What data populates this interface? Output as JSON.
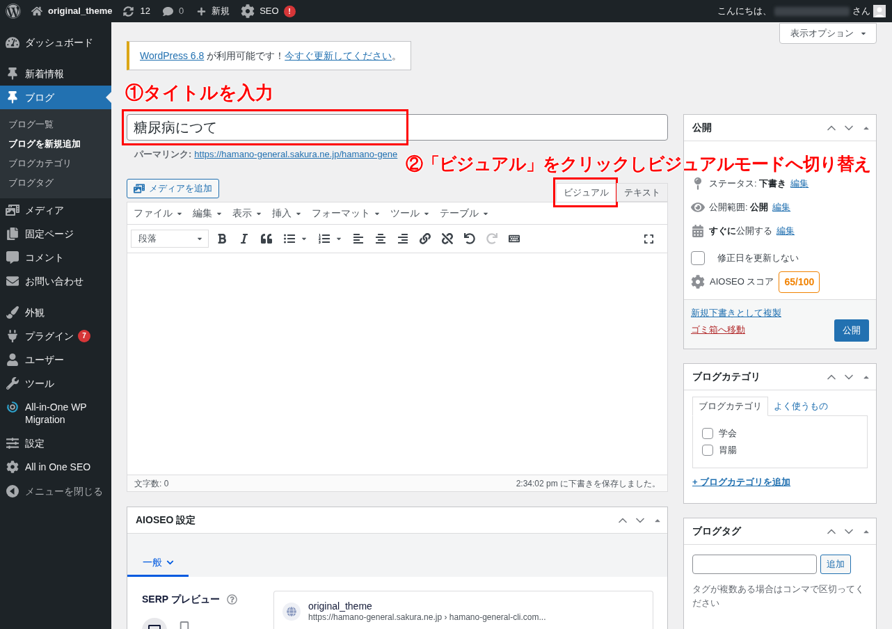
{
  "admin_bar": {
    "site_name": "original_theme",
    "updates_count": "12",
    "comments_count": "0",
    "new_label": "新規",
    "seo_label": "SEO",
    "seo_badge": "!",
    "greeting": "こんにちは、",
    "greeting_suffix": "さん"
  },
  "sidebar": {
    "groups": [
      {
        "items": [
          {
            "label": "ダッシュボード",
            "selected": false
          }
        ]
      },
      {
        "items": [
          {
            "label": "新着情報",
            "selected": false
          },
          {
            "label": "ブログ",
            "selected": true,
            "children": [
              {
                "label": "ブログ一覧",
                "selected": false
              },
              {
                "label": "ブログを新規追加",
                "selected": true
              },
              {
                "label": "ブログカテゴリ",
                "selected": false
              },
              {
                "label": "ブログタグ",
                "selected": false
              }
            ]
          },
          {
            "label": "メディア",
            "selected": false
          },
          {
            "label": "固定ページ",
            "selected": false
          },
          {
            "label": "コメント",
            "selected": false
          },
          {
            "label": "お問い合わせ",
            "selected": false
          }
        ]
      },
      {
        "items": [
          {
            "label": "外観",
            "selected": false
          },
          {
            "label": "プラグイン",
            "selected": false,
            "badge": "7"
          },
          {
            "label": "ユーザー",
            "selected": false
          },
          {
            "label": "ツール",
            "selected": false
          },
          {
            "label": "All-in-One WP Migration",
            "selected": false
          },
          {
            "label": "設定",
            "selected": false
          },
          {
            "label": "All in One SEO",
            "selected": false
          }
        ]
      }
    ],
    "collapse_label": "メニューを閉じる"
  },
  "screen_options": "表示オプション",
  "notice": {
    "parts": [
      {
        "kind": "link",
        "text": "WordPress 6.8"
      },
      {
        "kind": "text",
        "text": " が利用可能です！"
      },
      {
        "kind": "link",
        "text": "今すぐ更新してください"
      },
      {
        "kind": "text",
        "text": "。"
      }
    ]
  },
  "annotations": [
    {
      "text": "①タイトルを入力"
    },
    {
      "text": "②「ビジュアル」をクリックしビジュアルモードへ切り替え"
    }
  ],
  "editor": {
    "title": {
      "value": "糖尿病につて",
      "highlighted": true
    },
    "permalink": {
      "label": "パーマリンク:",
      "url": "https://hamano-general.sakura.ne.jp/hamano-gene"
    },
    "add_media": "メディアを追加",
    "tabs": [
      {
        "label": "ビジュアル",
        "selected": true,
        "highlighted": true
      },
      {
        "label": "テキスト",
        "selected": false,
        "highlighted": false
      }
    ],
    "menus": [
      "ファイル",
      "編集",
      "表示",
      "挿入",
      "フォーマット",
      "ツール",
      "テーブル"
    ],
    "format": "段落",
    "toolbar": {
      "redo_disabled": true
    },
    "word_count": "文字数: 0",
    "save_status": "2:34:02 pm に下書きを保存しました。"
  },
  "aioseo": {
    "title": "AIOSEO 設定",
    "tabs": [
      {
        "label": "一般",
        "selected": true
      }
    ],
    "serp_label": "SERP プレビュー",
    "preview": {
      "site_name": "original_theme",
      "url": "https://hamano-general.sakura.ne.jp › hamano-general-cli.com..."
    }
  },
  "publish": {
    "title": "公開",
    "rows": [
      {
        "text": "ステータス: **下書き**",
        "link": "編集"
      },
      {
        "text": "公開範囲: **公開**",
        "link": "編集"
      },
      {
        "text": "**すぐに**公開する",
        "link": "編集"
      }
    ],
    "checkbox": {
      "label": "修正日を更新しない",
      "checked": false
    },
    "score": {
      "label": "AIOSEO スコア",
      "value": "65/100"
    },
    "duplicate_link": "新規下書きとして複製",
    "trash_link": "ゴミ箱へ移動",
    "publish_button": "公開"
  },
  "categories": {
    "title": "ブログカテゴリ",
    "tabs": [
      {
        "label": "ブログカテゴリ",
        "selected": true
      },
      {
        "label": "よく使うもの",
        "selected": false
      }
    ],
    "items": [
      {
        "label": "学会",
        "checked": false
      },
      {
        "label": "胃腸",
        "checked": false
      }
    ],
    "add_link": "+ ブログカテゴリを追加"
  },
  "tags": {
    "title": "ブログタグ",
    "add_button": "追加",
    "hint": "タグが複数ある場合はコンマで区切ってください"
  }
}
